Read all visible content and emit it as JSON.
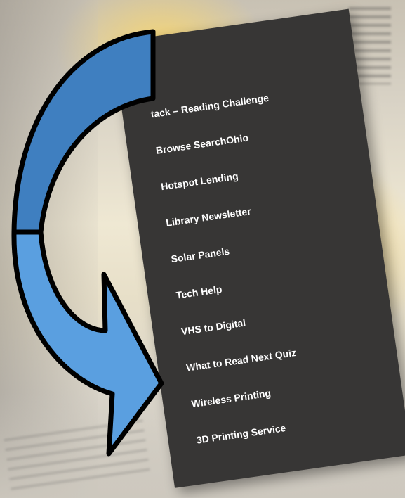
{
  "menu": {
    "items": [
      {
        "label": "tack – Reading Challenge"
      },
      {
        "label": "Browse SearchOhio"
      },
      {
        "label": "Hotspot Lending"
      },
      {
        "label": "Library Newsletter"
      },
      {
        "label": "Solar Panels"
      },
      {
        "label": "Tech Help"
      },
      {
        "label": "VHS to Digital"
      },
      {
        "label": "What to Read Next Quiz"
      },
      {
        "label": "Wireless Printing"
      },
      {
        "label": "3D Printing Service"
      }
    ]
  },
  "colors": {
    "menu_background": "#373635",
    "menu_text": "#ffffff",
    "arrow_top_fill": "#3f7fc0",
    "arrow_bottom_fill": "#5a9fe0",
    "arrow_outline": "#000000"
  },
  "icons": {
    "arrow": "curved-arrow-icon"
  }
}
